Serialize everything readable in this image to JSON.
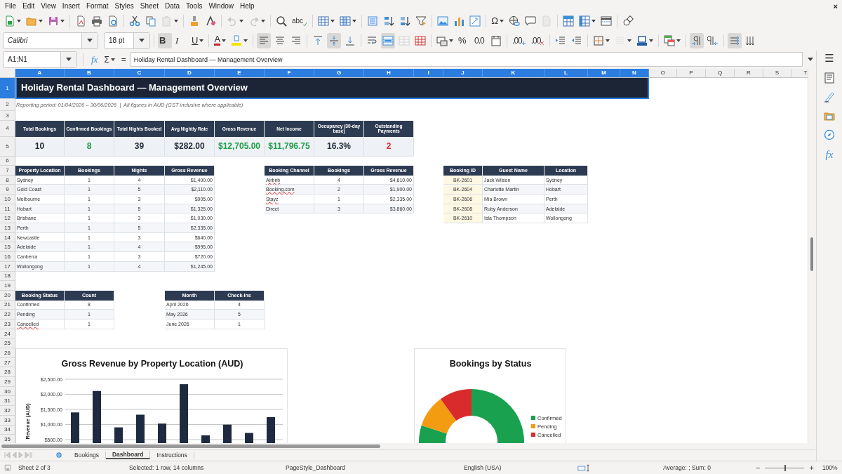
{
  "menu": {
    "items": [
      "File",
      "Edit",
      "View",
      "Insert",
      "Format",
      "Styles",
      "Sheet",
      "Data",
      "Tools",
      "Window",
      "Help"
    ],
    "close": "×"
  },
  "standard_toolbar": [
    [
      {
        "kind": "new",
        "dropdown": true,
        "disabled": false
      },
      {
        "kind": "open",
        "dropdown": true,
        "disabled": false
      },
      {
        "kind": "save",
        "dropdown": true,
        "disabled": false
      }
    ],
    [
      {
        "kind": "pdf",
        "dropdown": false,
        "disabled": false
      },
      {
        "kind": "print",
        "dropdown": false,
        "disabled": false
      },
      {
        "kind": "preview",
        "dropdown": false,
        "disabled": false
      }
    ],
    [
      {
        "kind": "cut",
        "dropdown": false,
        "disabled": false
      },
      {
        "kind": "copy",
        "dropdown": false,
        "disabled": false
      },
      {
        "kind": "paste",
        "dropdown": true,
        "disabled": true
      }
    ],
    [
      {
        "kind": "clone",
        "dropdown": false,
        "disabled": false
      },
      {
        "kind": "clear",
        "dropdown": false,
        "disabled": false
      }
    ],
    [
      {
        "kind": "undo",
        "dropdown": true,
        "disabled": true
      },
      {
        "kind": "redo",
        "dropdown": true,
        "disabled": true
      }
    ],
    [
      {
        "kind": "find",
        "dropdown": false,
        "disabled": false
      },
      {
        "kind": "spelling",
        "glyph": "abc",
        "dropdown": false,
        "disabled": false
      }
    ],
    [
      {
        "kind": "rows",
        "dropdown": true,
        "disabled": false
      },
      {
        "kind": "columns",
        "dropdown": true,
        "disabled": false
      }
    ],
    [
      {
        "kind": "sort",
        "dropdown": false,
        "disabled": false
      },
      {
        "kind": "sort-asc",
        "dropdown": false,
        "disabled": false
      },
      {
        "kind": "sort-desc",
        "dropdown": false,
        "disabled": false
      },
      {
        "kind": "autofilter",
        "dropdown": false,
        "disabled": false
      }
    ],
    [
      {
        "kind": "image",
        "dropdown": false,
        "disabled": false
      },
      {
        "kind": "chart",
        "dropdown": false,
        "disabled": false
      },
      {
        "kind": "pivot",
        "dropdown": false,
        "disabled": false
      }
    ],
    [
      {
        "kind": "special-char",
        "glyph": "Ω",
        "dropdown": true,
        "disabled": false
      },
      {
        "kind": "hyperlink",
        "dropdown": false,
        "disabled": false
      },
      {
        "kind": "comment",
        "dropdown": false,
        "disabled": false
      },
      {
        "kind": "header-footer",
        "dropdown": false,
        "disabled": true
      }
    ],
    [
      {
        "kind": "freeze",
        "dropdown": false,
        "disabled": false
      },
      {
        "kind": "freeze-columns",
        "dropdown": true,
        "disabled": false
      },
      {
        "kind": "split",
        "dropdown": false,
        "disabled": false
      }
    ],
    [
      {
        "kind": "shapes",
        "dropdown": false,
        "disabled": false
      }
    ]
  ],
  "formatting_toolbar": {
    "font": "Calibri",
    "size": "18 pt",
    "groups": [
      [
        {
          "kind": "bold",
          "glyph": "B",
          "pressed": true,
          "dropdown": false,
          "disabled": false
        },
        {
          "kind": "italic",
          "glyph": "I",
          "pressed": false,
          "dropdown": false,
          "disabled": false
        },
        {
          "kind": "underline",
          "glyph": "U",
          "pressed": false,
          "dropdown": true,
          "disabled": false
        }
      ],
      [
        {
          "kind": "font-color",
          "glyph": "A",
          "pressed": false,
          "dropdown": true,
          "disabled": false
        },
        {
          "kind": "highlight",
          "pressed": false,
          "dropdown": true,
          "disabled": false
        }
      ],
      [
        {
          "kind": "align-left",
          "pressed": true,
          "dropdown": false,
          "disabled": false
        },
        {
          "kind": "align-center",
          "pressed": false,
          "dropdown": false,
          "disabled": false
        },
        {
          "kind": "align-right",
          "pressed": false,
          "dropdown": false,
          "disabled": false
        }
      ],
      [
        {
          "kind": "align-top",
          "pressed": false,
          "dropdown": false,
          "disabled": false
        },
        {
          "kind": "align-middle",
          "pressed": true,
          "dropdown": false,
          "disabled": false
        },
        {
          "kind": "align-bottom",
          "pressed": false,
          "dropdown": false,
          "disabled": false
        }
      ],
      [
        {
          "kind": "wrap",
          "pressed": false,
          "dropdown": false,
          "disabled": false
        },
        {
          "kind": "merge-center",
          "pressed": true,
          "dropdown": false,
          "disabled": false
        },
        {
          "kind": "merge",
          "pressed": false,
          "dropdown": false,
          "disabled": true
        },
        {
          "kind": "unmerge",
          "pressed": false,
          "dropdown": false,
          "disabled": false
        }
      ],
      [
        {
          "kind": "currency",
          "pressed": false,
          "dropdown": true,
          "disabled": false
        },
        {
          "kind": "percent",
          "glyph": "%",
          "pressed": false,
          "dropdown": false,
          "disabled": false
        },
        {
          "kind": "number",
          "glyph": "0.0",
          "pressed": false,
          "dropdown": false,
          "disabled": false
        },
        {
          "kind": "date",
          "pressed": false,
          "dropdown": false,
          "disabled": false
        }
      ],
      [
        {
          "kind": "add-decimal",
          "glyph": ".00",
          "pressed": false,
          "dropdown": false,
          "disabled": false
        },
        {
          "kind": "delete-decimal",
          "glyph": ".00",
          "pressed": false,
          "dropdown": false,
          "disabled": false
        }
      ],
      [
        {
          "kind": "indent",
          "pressed": false,
          "dropdown": false,
          "disabled": false
        },
        {
          "kind": "outdent",
          "pressed": false,
          "dropdown": false,
          "disabled": false
        }
      ],
      [
        {
          "kind": "borders",
          "pressed": false,
          "dropdown": true,
          "disabled": false
        },
        {
          "kind": "border-style",
          "pressed": false,
          "dropdown": true,
          "disabled": true
        },
        {
          "kind": "border-color",
          "pressed": false,
          "dropdown": true,
          "disabled": false
        }
      ],
      [
        {
          "kind": "conditional",
          "pressed": false,
          "dropdown": true,
          "disabled": false
        }
      ],
      [
        {
          "kind": "ltr",
          "pressed": true,
          "dropdown": false,
          "disabled": false
        },
        {
          "kind": "rtl",
          "pressed": false,
          "dropdown": false,
          "disabled": false
        }
      ],
      [
        {
          "kind": "text-direction",
          "pressed": true,
          "dropdown": false,
          "disabled": false
        },
        {
          "kind": "vertical-text",
          "pressed": false,
          "dropdown": false,
          "disabled": false
        }
      ]
    ]
  },
  "formula_bar": {
    "name_box": "A1:N1",
    "function_wizard": "fx",
    "sum": "Σ",
    "equals": "=",
    "content": "Holiday Rental Dashboard — Management Overview"
  },
  "sidebar": {
    "items": [
      {
        "kind": "menu",
        "glyph": "☰"
      },
      {
        "kind": "properties"
      },
      {
        "kind": "styles"
      },
      {
        "kind": "gallery"
      },
      {
        "kind": "navigator"
      },
      {
        "kind": "functions",
        "glyph": "fx"
      }
    ]
  },
  "sheet": {
    "columns": [
      {
        "label": "A",
        "selected": true
      },
      {
        "label": "B",
        "selected": true
      },
      {
        "label": "C",
        "selected": true
      },
      {
        "label": "D",
        "selected": true
      },
      {
        "label": "E",
        "selected": true
      },
      {
        "label": "F",
        "selected": true
      },
      {
        "label": "G",
        "selected": true
      },
      {
        "label": "H",
        "selected": true
      },
      {
        "label": "I",
        "selected": true
      },
      {
        "label": "J",
        "selected": true
      },
      {
        "label": "K",
        "selected": true
      },
      {
        "label": "L",
        "selected": true
      },
      {
        "label": "M",
        "selected": true
      },
      {
        "label": "N",
        "selected": true
      },
      {
        "label": "O",
        "selected": false
      },
      {
        "label": "P",
        "selected": false
      },
      {
        "label": "Q",
        "selected": false
      },
      {
        "label": "R",
        "selected": false
      },
      {
        "label": "S",
        "selected": false
      },
      {
        "label": "T",
        "selected": false
      }
    ],
    "rows": [
      {
        "label": "1",
        "selected": true
      },
      {
        "label": "2",
        "selected": false
      },
      {
        "label": "3",
        "selected": false
      },
      {
        "label": "4",
        "selected": false
      },
      {
        "label": "5",
        "selected": false
      },
      {
        "label": "6",
        "selected": false
      },
      {
        "label": "7",
        "selected": false
      },
      {
        "label": "8",
        "selected": false
      },
      {
        "label": "9",
        "selected": false
      },
      {
        "label": "10",
        "selected": false
      },
      {
        "label": "11",
        "selected": false
      },
      {
        "label": "12",
        "selected": false
      },
      {
        "label": "13",
        "selected": false
      },
      {
        "label": "14",
        "selected": false
      },
      {
        "label": "15",
        "selected": false
      },
      {
        "label": "16",
        "selected": false
      },
      {
        "label": "17",
        "selected": false
      },
      {
        "label": "18",
        "selected": false
      },
      {
        "label": "19",
        "selected": false
      },
      {
        "label": "20",
        "selected": false
      },
      {
        "label": "21",
        "selected": false
      },
      {
        "label": "22",
        "selected": false
      },
      {
        "label": "23",
        "selected": false
      },
      {
        "label": "24",
        "selected": false
      },
      {
        "label": "25",
        "selected": false
      },
      {
        "label": "26",
        "selected": false
      },
      {
        "label": "27",
        "selected": false
      },
      {
        "label": "28",
        "selected": false
      },
      {
        "label": "29",
        "selected": false
      },
      {
        "label": "30",
        "selected": false
      },
      {
        "label": "31",
        "selected": false
      },
      {
        "label": "32",
        "selected": false
      },
      {
        "label": "33",
        "selected": false
      },
      {
        "label": "34",
        "selected": false
      },
      {
        "label": "35",
        "selected": false
      }
    ],
    "title": "Holiday Rental Dashboard — Management Overview",
    "subtitle": "Reporting period: 01/04/2026 – 30/06/2026  |  All figures in AUD (GST inclusive where applicable)",
    "kpis": [
      {
        "label": "Total Bookings",
        "value": "10",
        "color": "#1f2937"
      },
      {
        "label": "Confirmed Bookings",
        "value": "8",
        "color": "#1e9e48"
      },
      {
        "label": "Total Nights Booked",
        "value": "39",
        "color": "#1f2937"
      },
      {
        "label": "Avg Nightly Rate",
        "value": "$282.00",
        "color": "#1f2937"
      },
      {
        "label": "Gross Revenue",
        "value": "$12,705.00",
        "color": "#1e9e48"
      },
      {
        "label": "Net Income",
        "value": "$11,796.75",
        "color": "#1e9e48"
      },
      {
        "label": "Occupancy (30-day base)",
        "value": "16.3%",
        "color": "#1f2937"
      },
      {
        "label": "Outstanding Payments",
        "value": "2",
        "color": "#d62d2d"
      }
    ],
    "tables": [
      {
        "columns": [
          "Property Location",
          "Bookings",
          "Nights",
          "Gross Revenue"
        ],
        "rows": [
          {
            "cells": [
              "Sydney",
              "1",
              "4",
              "$1,400.00"
            ]
          },
          {
            "cells": [
              "Gold Coast",
              "1",
              "5",
              "$2,110.00"
            ]
          },
          {
            "cells": [
              "Melbourne",
              "1",
              "3",
              "$905.00"
            ]
          },
          {
            "cells": [
              "Hobart",
              "1",
              "5",
              "$1,325.00"
            ]
          },
          {
            "cells": [
              "Brisbane",
              "1",
              "3",
              "$1,030.00"
            ]
          },
          {
            "cells": [
              "Perth",
              "1",
              "5",
              "$2,335.00"
            ]
          },
          {
            "cells": [
              "Newcastle",
              "1",
              "3",
              "$640.00"
            ]
          },
          {
            "cells": [
              "Adelaide",
              "1",
              "4",
              "$995.00"
            ]
          },
          {
            "cells": [
              "Canberra",
              "1",
              "3",
              "$720.00"
            ]
          },
          {
            "cells": [
              "Wollongong",
              "1",
              "4",
              "$1,245.00"
            ]
          }
        ]
      },
      {
        "columns": [
          "Booking Channel",
          "Bookings",
          "Gross Revenue"
        ],
        "rows": [
          {
            "cells": [
              "Airbnb",
              "4",
              "$4,610.00"
            ],
            "misspelled": true
          },
          {
            "cells": [
              "Booking.com",
              "2",
              "$1,900.00"
            ],
            "misspelled": true
          },
          {
            "cells": [
              "Stayz",
              "1",
              "$2,335.00"
            ],
            "misspelled": true
          },
          {
            "cells": [
              "Direct",
              "3",
              "$3,860.00"
            ],
            "misspelled": false
          }
        ]
      },
      {
        "columns": [
          "Booking ID",
          "Guest Name",
          "Location"
        ],
        "rows": [
          {
            "cells": [
              "BK-2601",
              "Jack Wilson",
              "Sydney"
            ]
          },
          {
            "cells": [
              "BK-2604",
              "Charlotte Martin",
              "Hobart"
            ]
          },
          {
            "cells": [
              "BK-2606",
              "Mia Brown",
              "Perth"
            ]
          },
          {
            "cells": [
              "BK-2608",
              "Ruby Anderson",
              "Adelaide"
            ]
          },
          {
            "cells": [
              "BK-2610",
              "Isla Thompson",
              "Wollongong"
            ]
          }
        ]
      },
      {
        "columns": [
          "Booking Status",
          "Count"
        ],
        "rows": [
          {
            "cells": [
              "Confirmed",
              "8"
            ],
            "misspelled": false
          },
          {
            "cells": [
              "Pending",
              "1"
            ],
            "misspelled": false
          },
          {
            "cells": [
              "Cancelled",
              "1"
            ],
            "misspelled": true
          }
        ]
      },
      {
        "columns": [
          "Month",
          "Check-ins"
        ],
        "rows": [
          {
            "cells": [
              "April 2026",
              "4"
            ]
          },
          {
            "cells": [
              "May 2026",
              "5"
            ]
          },
          {
            "cells": [
              "June 2026",
              "1"
            ]
          }
        ]
      }
    ],
    "charts": [
      {
        "chart_data": {
          "type": "bar",
          "title": "Gross Revenue by Property Location (AUD)",
          "ylabel": "Revenue (AUD)",
          "grid": true,
          "series": [
            {
              "color": "#1e2a3f",
              "values": [
                1400,
                2110,
                905,
                1325,
                1030,
                2335,
                640,
                995,
                720,
                1245
              ]
            }
          ],
          "ylim": [
            0,
            2500
          ],
          "yticks": [
            {
              "value": 500,
              "label": "$500.00"
            },
            {
              "value": 1000,
              "label": "$1,000.00"
            },
            {
              "value": 1500,
              "label": "$1,500.00"
            },
            {
              "value": 2000,
              "label": "$2,000.00"
            },
            {
              "value": 2500,
              "label": "$2,500.00"
            }
          ]
        }
      },
      {
        "chart_data": {
          "type": "donut",
          "title": "Bookings by Status",
          "categories": [
            "Confirmed",
            "Pending",
            "Cancelled"
          ],
          "values": [
            80,
            10,
            10
          ],
          "colors": [
            "#1aa14f",
            "#f39c12",
            "#d92b2b"
          ],
          "legend": true
        }
      }
    ]
  },
  "sheet_tabs": {
    "tabs": [
      {
        "label": "Bookings",
        "selected": false
      },
      {
        "label": "Dashboard",
        "selected": true
      },
      {
        "label": "Instructions",
        "selected": false
      }
    ]
  },
  "status_bar": {
    "sheet": "Sheet 2 of 3",
    "selection": "Selected: 1 row, 14 columns",
    "page_style": "PageStyle_Dashboard",
    "language": "English (USA)",
    "summary": "Average: ; Sum: 0",
    "zoom_out": "−",
    "zoom_in": "+",
    "zoom_slider": {
      "level": 0.5
    },
    "zoom": "100%"
  }
}
